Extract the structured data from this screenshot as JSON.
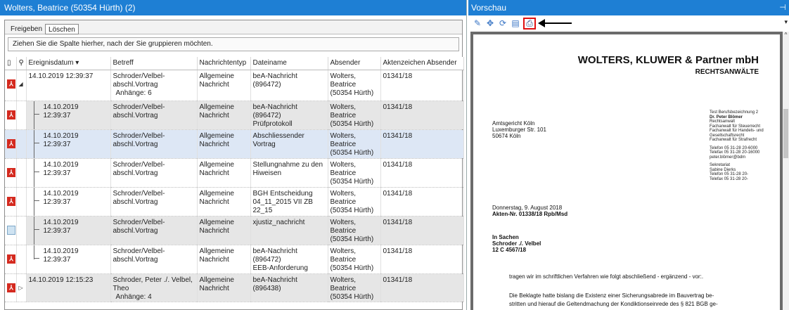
{
  "left": {
    "title": "Wolters, Beatrice (50354 Hürth) (2)",
    "tabs": [
      "Freigeben",
      "Löschen"
    ],
    "group_hint": "Ziehen Sie die Spalte hierher, nach der Sie gruppieren möchten.",
    "columns": [
      "Ereignisdatum",
      "Betreff",
      "Nachrichtentyp",
      "Dateiname",
      "Absender",
      "Aktenzeichen Absender"
    ],
    "rows": [
      {
        "date": "14.10.2019 12:39:37",
        "subject": "Schroder/Velbel-abschl.Vortrag",
        "subject2": "Anhänge: 6",
        "type": "Allgemeine",
        "type2": "Nachricht",
        "file": "beA-Nachricht (896472)",
        "file2": "",
        "sender": "Wolters, Beatrice",
        "sender2": "(50354 Hürth)",
        "ref": "01341/18"
      },
      {
        "date": "14.10.2019",
        "date2": "12:39:37",
        "subject": "Schroder/Velbel-abschl.Vortrag",
        "type": "Allgemeine",
        "type2": "Nachricht",
        "file": "beA-Nachricht (896472)",
        "file2": "Prüfprotokoll",
        "sender": "Wolters, Beatrice",
        "sender2": "(50354 Hürth)",
        "ref": "01341/18"
      },
      {
        "date": "14.10.2019",
        "date2": "12:39:37",
        "subject": "Schroder/Velbel-abschl.Vortrag",
        "type": "Allgemeine",
        "type2": "Nachricht",
        "file": "Abschliessender Vortrag",
        "file2": "",
        "sender": "Wolters, Beatrice",
        "sender2": "(50354 Hürth)",
        "ref": "01341/18"
      },
      {
        "date": "14.10.2019",
        "date2": "12:39:37",
        "subject": "Schroder/Velbel-abschl.Vortrag",
        "type": "Allgemeine",
        "type2": "Nachricht",
        "file": "Stellungnahme zu den",
        "file2": "Hiweisen",
        "sender": "Wolters, Beatrice",
        "sender2": "(50354 Hürth)",
        "ref": "01341/18"
      },
      {
        "date": "14.10.2019",
        "date2": "12:39:37",
        "subject": "Schroder/Velbel-abschl.Vortrag",
        "type": "Allgemeine",
        "type2": "Nachricht",
        "file": "BGH Entscheidung",
        "file2": "04_11_2015 VII ZB 22_15",
        "sender": "Wolters, Beatrice",
        "sender2": "(50354 Hürth)",
        "ref": "01341/18"
      },
      {
        "date": "14.10.2019",
        "date2": "12:39:37",
        "subject": "Schroder/Velbel-abschl.Vortrag",
        "type": "Allgemeine",
        "type2": "Nachricht",
        "file": "xjustiz_nachricht",
        "file2": "",
        "sender": "Wolters, Beatrice",
        "sender2": "(50354 Hürth)",
        "ref": "01341/18"
      },
      {
        "date": "14.10.2019",
        "date2": "12:39:37",
        "subject": "Schroder/Velbel-abschl.Vortrag",
        "type": "Allgemeine",
        "type2": "Nachricht",
        "file": "beA-Nachricht (896472)",
        "file2": "EEB-Anforderung",
        "sender": "Wolters, Beatrice",
        "sender2": "(50354 Hürth)",
        "ref": "01341/18"
      },
      {
        "date": "14.10.2019 12:15:23",
        "subject": "Schroder, Peter ./. Velbel, Theo",
        "subject2": "Anhänge: 4",
        "type": "Allgemeine",
        "type2": "Nachricht",
        "file": "beA-Nachricht (896438)",
        "file2": "",
        "sender": "Wolters, Beatrice",
        "sender2": "(50354 Hürth)",
        "ref": "01341/18"
      }
    ]
  },
  "right": {
    "title": "Vorschau",
    "doc": {
      "firm": "WOLTERS, KLUWER & Partner mbH",
      "firm_sub": "RECHTSANWÄLTE",
      "addr": [
        "Amtsgericht Köln",
        "Luxemburger Str. 101",
        "50674 Köln"
      ],
      "side": [
        "Test Berufsbezeichnung 2",
        "Dr. Peter Blömer",
        "Rechtsanwalt",
        "Fachanwalt für Steuerrecht",
        "Fachanwalt für Handels- und",
        "Gesellschaftsrecht",
        "Fachanwalt für Strafrecht",
        "",
        "Telefon 05 31-28 20-6000",
        "Telefax 05 31-28 20-16000",
        "peter.blömer@bdm",
        "",
        "Sekretariat",
        " Sabine Dierks",
        "Telefon 05 31-28 20-",
        "Telefax 05 31-28 20-"
      ],
      "date": "Donnerstag, 9. August 2018",
      "akten": "Akten-Nr. 01338/18 Rpb/Msd",
      "sachen": [
        "In Sachen",
        "Schroder ./. Velbel",
        "12 C 4567/18"
      ],
      "p1": "tragen wir im schriftlichen Verfahren wie folgt abschließend - ergänzend - vor:.",
      "p2a": "Die Beklagte hatte bislang die Existenz einer Sicherungsabrede im Bauvertrag be-",
      "p2b": "stritten und hierauf die Geltendmachung der Kondiktionseinrede des § 821 BGB ge-"
    }
  }
}
